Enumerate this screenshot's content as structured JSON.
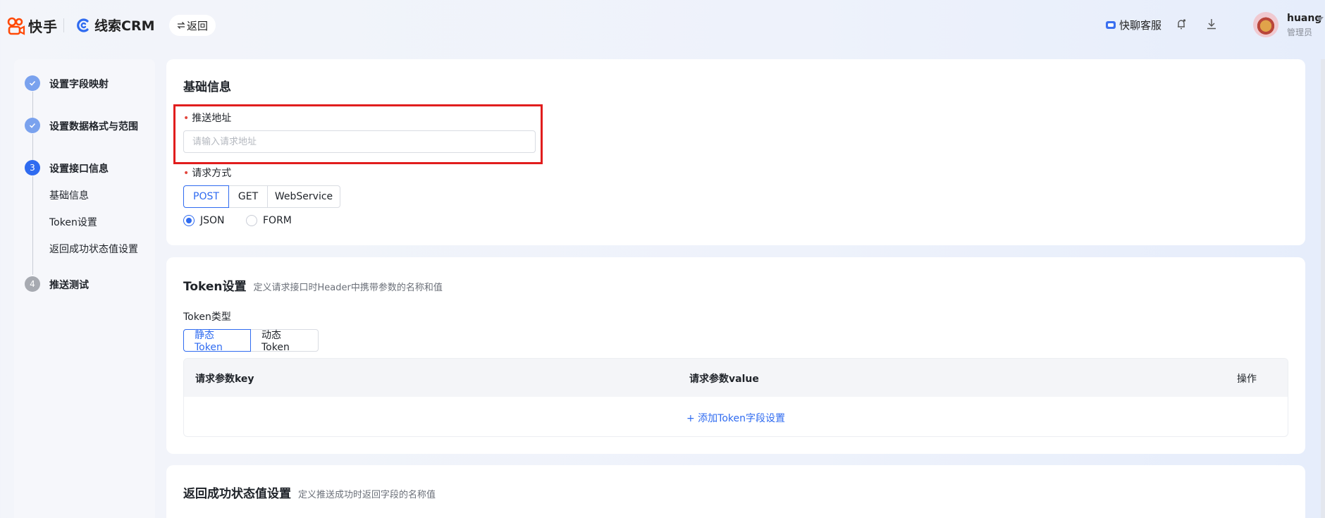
{
  "header": {
    "kuaishou_logo": "快手",
    "crm_logo": "线索CRM",
    "back_label": "返回",
    "back_icon": "swap-arrows-icon",
    "support_label": "快聊客服",
    "user_name": "huang",
    "user_role": "管理员"
  },
  "sidebar": {
    "steps": [
      {
        "label": "设置字段映射",
        "status": "done"
      },
      {
        "label": "设置数据格式与范围",
        "status": "done"
      },
      {
        "label": "设置接口信息",
        "status": "active",
        "number": "3"
      },
      {
        "label": "推送测试",
        "status": "todo",
        "number": "4"
      }
    ],
    "sub_items": [
      "基础信息",
      "Token设置",
      "返回成功状态值设置"
    ]
  },
  "basic_info": {
    "title": "基础信息",
    "url_label": "推送地址",
    "url_placeholder": "请输入请求地址",
    "url_value": "",
    "method_label": "请求方式",
    "methods": [
      "POST",
      "GET",
      "WebService"
    ],
    "selected_method": "POST",
    "formats": [
      "JSON",
      "FORM"
    ],
    "selected_format": "JSON"
  },
  "token": {
    "title": "Token设置",
    "desc": "定义请求接口时Header中携带参数的名称和值",
    "type_label": "Token类型",
    "types": [
      "静态Token",
      "动态Token"
    ],
    "selected_type": "静态Token",
    "table": {
      "columns": [
        "请求参数key",
        "请求参数value",
        "操作"
      ],
      "add_label": "添加Token字段设置"
    }
  },
  "return_status": {
    "title": "返回成功状态值设置",
    "desc": "定义推送成功时返回字段的名称值"
  },
  "colors": {
    "accent": "#2f6bf0",
    "required": "#e2463d",
    "highlight": "#e11d1d"
  }
}
